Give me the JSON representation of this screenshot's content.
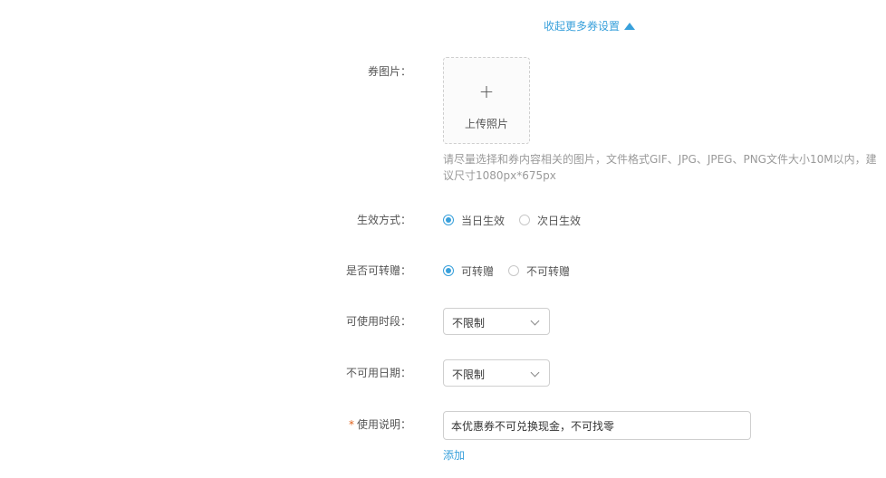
{
  "collapse": {
    "label": "收起更多券设置"
  },
  "image_field": {
    "label": "券图片：",
    "plus": "+",
    "upload_label": "上传照片",
    "hint": "请尽量选择和券内容相关的图片，文件格式GIF、JPG、JPEG、PNG文件大小10M以内，建议尺寸1080px*675px"
  },
  "effect_mode": {
    "label": "生效方式：",
    "options": [
      {
        "label": "当日生效",
        "checked": true
      },
      {
        "label": "次日生效",
        "checked": false
      }
    ]
  },
  "transferable": {
    "label": "是否可转赠：",
    "options": [
      {
        "label": "可转赠",
        "checked": true
      },
      {
        "label": "不可转赠",
        "checked": false
      }
    ]
  },
  "usable_period": {
    "label": "可使用时段：",
    "value": "不限制"
  },
  "unusable_dates": {
    "label": "不可用日期：",
    "value": "不限制"
  },
  "usage_note": {
    "required_mark": "*",
    "label": "使用说明：",
    "value": "本优惠券不可兑换现金，不可找零",
    "add_label": "添加"
  },
  "colors": {
    "accent": "#38a0db",
    "required": "#e0621d"
  },
  "icons": {
    "collapse": "triangle-up-icon",
    "select": "chevron-down-icon"
  }
}
